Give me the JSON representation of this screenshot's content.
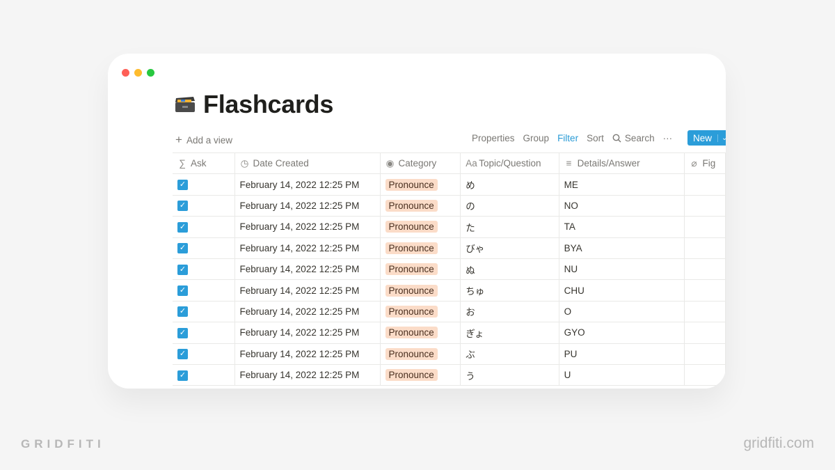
{
  "window": {
    "controls": {
      "close": "#fe5f57",
      "minimize": "#febc2e",
      "maximize": "#28c840"
    }
  },
  "page": {
    "icon": "card-file-box-icon",
    "title": "Flashcards"
  },
  "toolbar": {
    "add_view": "Add a view",
    "properties": "Properties",
    "group": "Group",
    "filter": "Filter",
    "sort": "Sort",
    "search": "Search",
    "more": "···",
    "new": "New",
    "accent": "#2b9dd9"
  },
  "table": {
    "columns": [
      {
        "icon": "sigma-icon",
        "glyph": "∑",
        "label": "Ask"
      },
      {
        "icon": "clock-icon",
        "glyph": "◷",
        "label": "Date Created"
      },
      {
        "icon": "select-icon",
        "glyph": "◉",
        "label": "Category"
      },
      {
        "icon": "title-icon",
        "glyph": "Aa",
        "label": "Topic/Question"
      },
      {
        "icon": "text-icon",
        "glyph": "≡",
        "label": "Details/Answer"
      },
      {
        "icon": "paperclip-icon",
        "glyph": "⌀",
        "label": "Fig"
      }
    ],
    "rows": [
      {
        "ask": true,
        "date": "February 14, 2022 12:25 PM",
        "category": "Pronounce",
        "topic": "め",
        "answer": "ME"
      },
      {
        "ask": true,
        "date": "February 14, 2022 12:25 PM",
        "category": "Pronounce",
        "topic": "の",
        "answer": "NO"
      },
      {
        "ask": true,
        "date": "February 14, 2022 12:25 PM",
        "category": "Pronounce",
        "topic": "た",
        "answer": "TA"
      },
      {
        "ask": true,
        "date": "February 14, 2022 12:25 PM",
        "category": "Pronounce",
        "topic": "びゃ",
        "answer": "BYA"
      },
      {
        "ask": true,
        "date": "February 14, 2022 12:25 PM",
        "category": "Pronounce",
        "topic": "ぬ",
        "answer": "NU"
      },
      {
        "ask": true,
        "date": "February 14, 2022 12:25 PM",
        "category": "Pronounce",
        "topic": "ちゅ",
        "answer": "CHU"
      },
      {
        "ask": true,
        "date": "February 14, 2022 12:25 PM",
        "category": "Pronounce",
        "topic": "お",
        "answer": "O"
      },
      {
        "ask": true,
        "date": "February 14, 2022 12:25 PM",
        "category": "Pronounce",
        "topic": "ぎょ",
        "answer": "GYO"
      },
      {
        "ask": true,
        "date": "February 14, 2022 12:25 PM",
        "category": "Pronounce",
        "topic": "ぶ",
        "answer": "PU"
      },
      {
        "ask": true,
        "date": "February 14, 2022 12:25 PM",
        "category": "Pronounce",
        "topic": "う",
        "answer": "U"
      }
    ]
  },
  "watermark": {
    "left": "GRIDFITI",
    "right": "gridfiti.com"
  }
}
